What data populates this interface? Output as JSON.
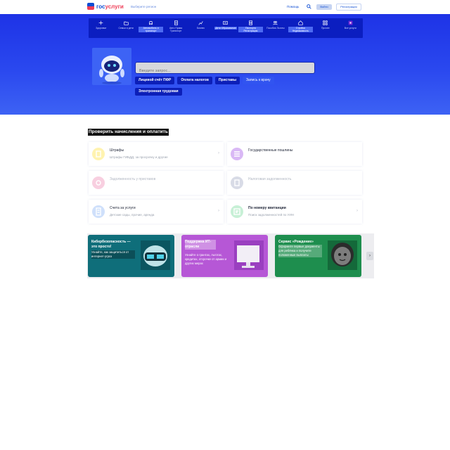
{
  "header": {
    "logo_a": "гос",
    "logo_b": "услуги",
    "region": "Выберите регион",
    "help": "Помощь",
    "login": "Войти",
    "register": "Регистрация"
  },
  "categories": [
    {
      "label": "Здоровье",
      "icon": "health-icon",
      "selected": false
    },
    {
      "label": "Семья и дети",
      "icon": "family-icon",
      "selected": false
    },
    {
      "label": "Автомобиль и транспорт",
      "icon": "car-icon",
      "selected": true
    },
    {
      "label": "Авто Права Транспорт",
      "icon": "document-icon",
      "selected": false
    },
    {
      "label": "Бизнес",
      "icon": "business-icon",
      "selected": false
    },
    {
      "label": "Дети Образование",
      "icon": "education-icon",
      "selected": true
    },
    {
      "label": "Паспорта Регистрация",
      "icon": "passport-icon",
      "selected": true
    },
    {
      "label": "Пособия Льготы",
      "icon": "benefits-icon",
      "selected": false
    },
    {
      "label": "Стройка Недвижимость",
      "icon": "house-icon",
      "selected": true
    },
    {
      "label": "Прочее",
      "icon": "grid-icon",
      "selected": false
    },
    {
      "label": "Все услуги",
      "icon": "services-icon",
      "selected": false
    }
  ],
  "search": {
    "placeholder": "Введите запрос..."
  },
  "chips": [
    {
      "label": "Лицевой счёт ПФР",
      "style": "dark"
    },
    {
      "label": "Оплата налогов",
      "style": "dark"
    },
    {
      "label": "Приставы",
      "style": "dark"
    },
    {
      "label": "Запись к врачу",
      "style": "alt"
    },
    {
      "label": "Электронная трудовая",
      "style": "dark"
    }
  ],
  "section": {
    "title": "Проверить начисления и оплатить"
  },
  "tiles": [
    {
      "title": "Штрафы",
      "subtitle": "Штрафы ГИБДД, за просрочку и другие",
      "icon": "fine-icon",
      "icon_color": "#fff3b0",
      "title_style": "normal",
      "arrow": true
    },
    {
      "title": "Государственные пошлины",
      "subtitle": "",
      "icon": "duty-icon",
      "icon_color": "#d9b8f5",
      "title_style": "normal",
      "arrow": false
    },
    {
      "title": "Задолженность у приставов",
      "subtitle": "",
      "icon": "bailiff-icon",
      "icon_color": "#f8cfe0",
      "title_style": "faint",
      "arrow": false
    },
    {
      "title": "Налоговая задолженность",
      "subtitle": "",
      "icon": "tax-icon",
      "icon_color": "#d8dbe6",
      "title_style": "faint",
      "arrow": false
    },
    {
      "title": "Счета за услуги",
      "subtitle": "Детские сады, прочие, аренда",
      "icon": "bill-icon",
      "icon_color": "#cfe0fb",
      "title_style": "normal",
      "arrow": true
    },
    {
      "title": "По номеру квитанции",
      "subtitle": "Поиск задолженностей по УИН",
      "icon": "receipt-icon",
      "icon_color": "#c7f0d6",
      "title_style": "bold",
      "arrow": true
    }
  ],
  "banners": [
    {
      "title": "Кибербезопасность — это просто!",
      "desc": "Узнайте, как защититься от интернет-угроз",
      "color": "#0f6e7a",
      "pic": "shield-helmet-icon"
    },
    {
      "title": "Поддержка ИТ-отрасли",
      "desc": "Узнайте о грантах, льготах, кредитах, отсрочке от армии и других мерах",
      "color": "#b657d6",
      "pic": "monitor-icon"
    },
    {
      "title": "Сервис «Рождение»",
      "desc": "Оформите первые документы для ребёнка и получите положенные выплаты",
      "color": "#1e8e4e",
      "pic": "baby-icon"
    }
  ],
  "next_label": "›"
}
